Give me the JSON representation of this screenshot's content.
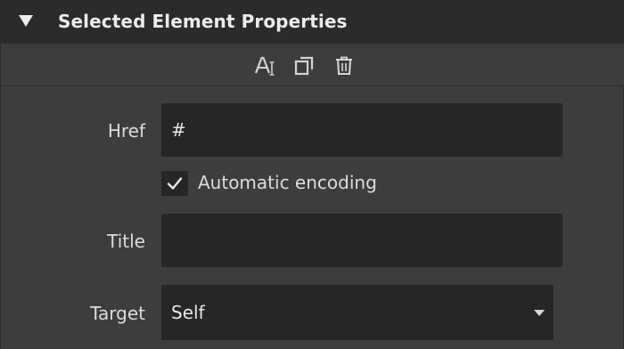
{
  "header": {
    "title": "Selected Element Properties"
  },
  "toolbar": {
    "icons": [
      "text-format-icon",
      "duplicate-icon",
      "trash-icon"
    ]
  },
  "fields": {
    "href": {
      "label": "Href",
      "value": "#"
    },
    "encoding": {
      "label": "Automatic encoding",
      "checked": true
    },
    "title": {
      "label": "Title",
      "value": ""
    },
    "target": {
      "label": "Target",
      "value": "Self"
    }
  },
  "colors": {
    "panel_bg": "#3d3d3d",
    "header_bg": "#2b2b2b",
    "field_bg": "#262626",
    "text": "#dcdcdc"
  }
}
